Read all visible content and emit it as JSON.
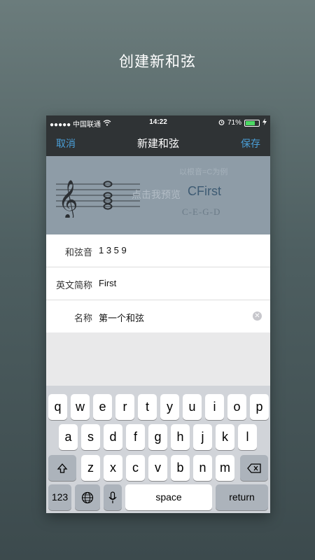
{
  "banner": "创建新和弦",
  "status": {
    "carrier": "●●●●● 中国联通",
    "time": "14:22",
    "battery": "71%",
    "battery_level": 0.71
  },
  "nav": {
    "cancel": "取消",
    "title": "新建和弦",
    "save": "保存"
  },
  "preview": {
    "hint": "以根音=C为例",
    "tap_hint": "点击我预览",
    "chord_name": "CFirst",
    "notes": "C-E-G-D"
  },
  "form": {
    "rows": [
      {
        "label": "和弦音",
        "value": "1 3 5 9"
      },
      {
        "label": "英文简称",
        "value": "First"
      },
      {
        "label": "名称",
        "value": "第一个和弦"
      }
    ]
  },
  "keyboard": {
    "row1": [
      "q",
      "w",
      "e",
      "r",
      "t",
      "y",
      "u",
      "i",
      "o",
      "p"
    ],
    "row2": [
      "a",
      "s",
      "d",
      "f",
      "g",
      "h",
      "j",
      "k",
      "l"
    ],
    "row3": [
      "z",
      "x",
      "c",
      "v",
      "b",
      "n",
      "m"
    ],
    "numbers": "123",
    "space": "space",
    "return": "return"
  },
  "icons": [
    "wifi-icon",
    "alarm-icon",
    "battery-icon",
    "charging-icon",
    "treble-clef-icon",
    "clear-icon",
    "shift-icon",
    "backspace-icon",
    "globe-icon",
    "microphone-icon"
  ]
}
